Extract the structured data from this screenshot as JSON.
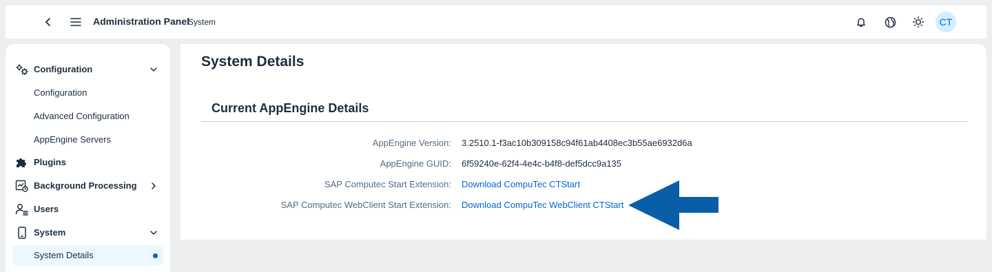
{
  "shell": {
    "title": "Administration Panel",
    "subtitle": "System",
    "avatar_initials": "CT",
    "icons": [
      "back-icon",
      "menu-icon",
      "bell-icon",
      "globe-icon",
      "sun-icon"
    ]
  },
  "sidebar": {
    "items": [
      {
        "label": "Configuration",
        "icon": "gears-icon",
        "type": "group",
        "expanded": true
      },
      {
        "label": "Configuration",
        "type": "sub"
      },
      {
        "label": "Advanced Configuration",
        "type": "sub"
      },
      {
        "label": "AppEngine Servers",
        "type": "sub"
      },
      {
        "label": "Plugins",
        "icon": "puzzle-icon",
        "type": "group"
      },
      {
        "label": "Background Processing",
        "icon": "background-processing-icon",
        "type": "group",
        "expanded": false
      },
      {
        "label": "Users",
        "icon": "user-list-icon",
        "type": "group"
      },
      {
        "label": "System",
        "icon": "device-icon",
        "type": "group",
        "expanded": true
      },
      {
        "label": "System Details",
        "type": "sub",
        "selected": true
      }
    ]
  },
  "main": {
    "page_title": "System Details",
    "section_title": "Current AppEngine Details",
    "details": [
      {
        "label": "AppEngine Version:",
        "value": "3.2510.1-f3ac10b309158c94f61ab4408ec3b55ae6932d6a"
      },
      {
        "label": "AppEngine GUID:",
        "value": "6f59240e-62f4-4e4c-b4f8-def5dcc9a135"
      },
      {
        "label": "SAP Computec Start Extension:",
        "link": "Download CompuTec CTStart"
      },
      {
        "label": "SAP Computec WebClient Start Extension:",
        "link": "Download CompuTec WebClient CTStart"
      }
    ]
  },
  "colors": {
    "accent": "#0064d9",
    "annotation_arrow": "#0a5ea8",
    "background": "#eceef0",
    "selected_bg": "#ebf8ff"
  }
}
